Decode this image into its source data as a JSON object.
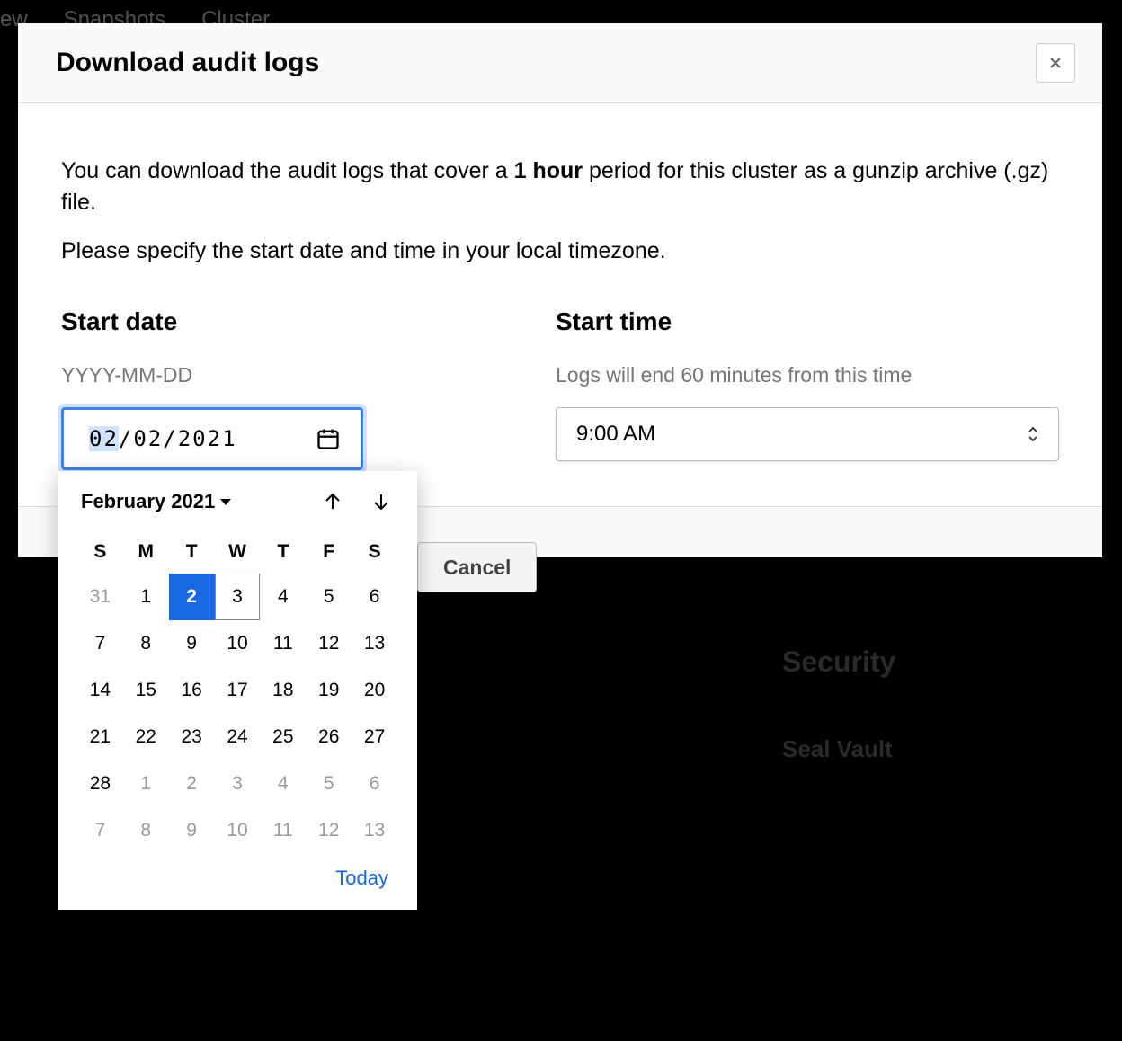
{
  "background": {
    "tabs": [
      "ew",
      "Snapshots",
      "Cluster"
    ],
    "security_heading": "Security",
    "seal_vault": "Seal Vault"
  },
  "modal": {
    "title": "Download audit logs",
    "intro_prefix": "You can download the audit logs that cover a ",
    "intro_bold": "1 hour",
    "intro_suffix": " period for this cluster as a gunzip archive (.gz) file.",
    "instruction": "Please specify the start date and time in your local timezone.",
    "start_date": {
      "label": "Start date",
      "hint": "YYYY-MM-DD",
      "value_month": "02",
      "value_sep1": "/",
      "value_day": "02",
      "value_sep2": "/",
      "value_year": "2021"
    },
    "start_time": {
      "label": "Start time",
      "hint": "Logs will end 60 minutes from this time",
      "value": "9:00 AM"
    },
    "buttons": {
      "cancel": "Cancel"
    }
  },
  "datepicker": {
    "month_year": "February 2021",
    "dow": [
      "S",
      "M",
      "T",
      "W",
      "T",
      "F",
      "S"
    ],
    "weeks": [
      [
        {
          "n": "31",
          "other": true
        },
        {
          "n": "1"
        },
        {
          "n": "2",
          "selected": true
        },
        {
          "n": "3",
          "today": true
        },
        {
          "n": "4"
        },
        {
          "n": "5"
        },
        {
          "n": "6"
        }
      ],
      [
        {
          "n": "7"
        },
        {
          "n": "8"
        },
        {
          "n": "9"
        },
        {
          "n": "10"
        },
        {
          "n": "11"
        },
        {
          "n": "12"
        },
        {
          "n": "13"
        }
      ],
      [
        {
          "n": "14"
        },
        {
          "n": "15"
        },
        {
          "n": "16"
        },
        {
          "n": "17"
        },
        {
          "n": "18"
        },
        {
          "n": "19"
        },
        {
          "n": "20"
        }
      ],
      [
        {
          "n": "21"
        },
        {
          "n": "22"
        },
        {
          "n": "23"
        },
        {
          "n": "24"
        },
        {
          "n": "25"
        },
        {
          "n": "26"
        },
        {
          "n": "27"
        }
      ],
      [
        {
          "n": "28"
        },
        {
          "n": "1",
          "other": true
        },
        {
          "n": "2",
          "other": true
        },
        {
          "n": "3",
          "other": true
        },
        {
          "n": "4",
          "other": true
        },
        {
          "n": "5",
          "other": true
        },
        {
          "n": "6",
          "other": true
        }
      ],
      [
        {
          "n": "7",
          "other": true
        },
        {
          "n": "8",
          "other": true
        },
        {
          "n": "9",
          "other": true
        },
        {
          "n": "10",
          "other": true
        },
        {
          "n": "11",
          "other": true
        },
        {
          "n": "12",
          "other": true
        },
        {
          "n": "13",
          "other": true
        }
      ]
    ],
    "today_label": "Today"
  }
}
